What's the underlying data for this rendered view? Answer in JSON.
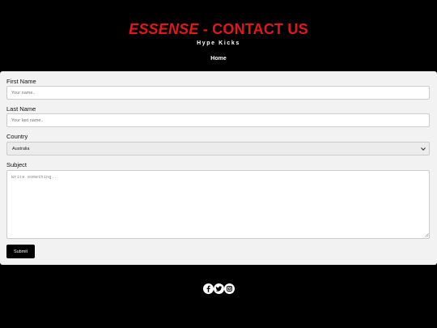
{
  "header": {
    "brand": "ESSENSE",
    "title_rest": " - CONTACT US",
    "tagline": "Hype Kicks"
  },
  "nav": {
    "items": [
      {
        "label": "Home"
      }
    ]
  },
  "form": {
    "first_name": {
      "label": "First Name",
      "placeholder": "Your name..",
      "value": ""
    },
    "last_name": {
      "label": "Last Name",
      "placeholder": "Your last name..",
      "value": ""
    },
    "country": {
      "label": "Country",
      "selected": "Australia"
    },
    "subject": {
      "label": "Subject",
      "placeholder": "Write something..",
      "value": ""
    },
    "submit_label": "Submit"
  },
  "footer": {
    "social_icons": [
      "facebook-icon",
      "twitter-icon",
      "instagram-icon"
    ]
  },
  "colors": {
    "background": "#000000",
    "panel": "#f2f2f2",
    "accent": "#e3171a",
    "button": "#000000"
  }
}
